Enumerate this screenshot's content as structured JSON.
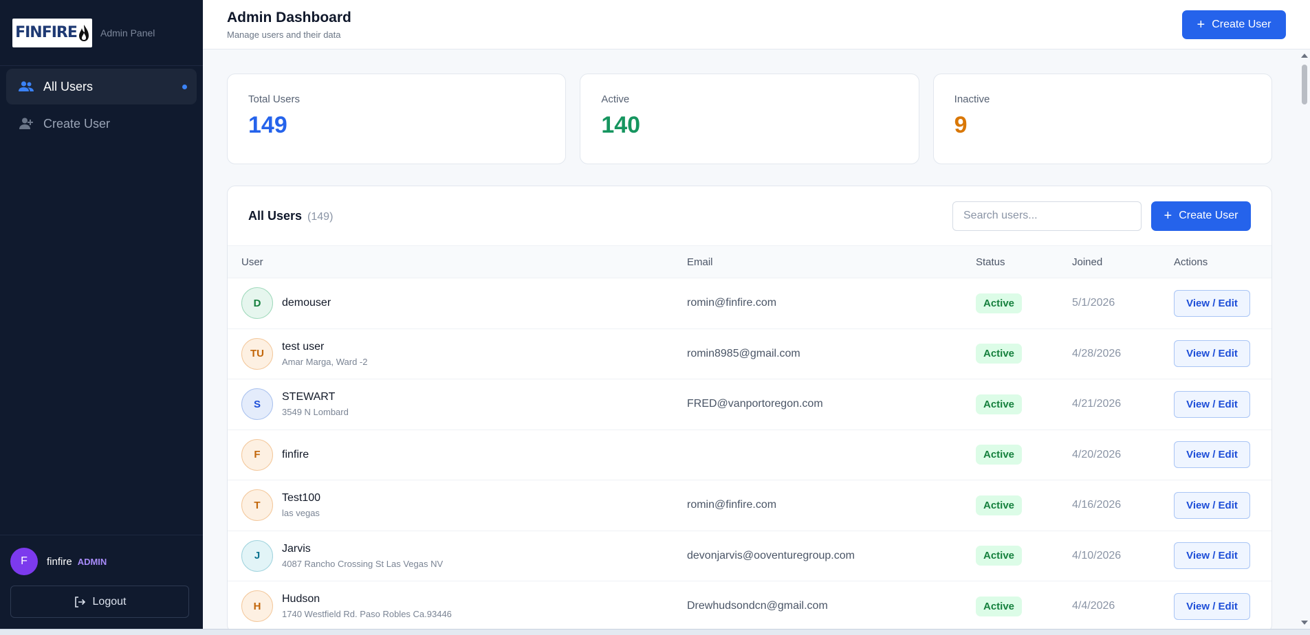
{
  "brand": {
    "logo_text": "FINFIRE",
    "subtitle": "Admin Panel"
  },
  "sidebar": {
    "items": [
      {
        "label": "All Users",
        "icon": "users-icon",
        "active": true
      },
      {
        "label": "Create User",
        "icon": "user-plus-icon",
        "active": false
      }
    ],
    "user": {
      "initial": "F",
      "name": "finfire",
      "role": "ADMIN"
    },
    "logout_label": "Logout"
  },
  "header": {
    "title": "Admin Dashboard",
    "subtitle": "Manage users and their data",
    "create_label": "Create User"
  },
  "stats": [
    {
      "label": "Total Users",
      "value": "149",
      "color": "#2563eb"
    },
    {
      "label": "Active",
      "value": "140",
      "color": "#16955f"
    },
    {
      "label": "Inactive",
      "value": "9",
      "color": "#d97706"
    }
  ],
  "panel": {
    "title": "All Users",
    "count": "(149)",
    "search_placeholder": "Search users...",
    "create_label": "Create User"
  },
  "table": {
    "headers": [
      "User",
      "Email",
      "Status",
      "Joined",
      "Actions"
    ],
    "action_label": "View / Edit",
    "rows": [
      {
        "initials": "D",
        "name": "demouser",
        "address": "",
        "email": "romin@finfire.com",
        "status": "Active",
        "joined": "5/1/2026",
        "avatar_color": "green"
      },
      {
        "initials": "TU",
        "name": "test user",
        "address": "Amar Marga, Ward -2",
        "email": "romin8985@gmail.com",
        "status": "Active",
        "joined": "4/28/2026",
        "avatar_color": "orange"
      },
      {
        "initials": "S",
        "name": "STEWART",
        "address": "3549 N Lombard",
        "email": "FRED@vanportoregon.com",
        "status": "Active",
        "joined": "4/21/2026",
        "avatar_color": "blue"
      },
      {
        "initials": "F",
        "name": "finfire",
        "address": "",
        "email": "",
        "status": "Active",
        "joined": "4/20/2026",
        "avatar_color": "orange"
      },
      {
        "initials": "T",
        "name": "Test100",
        "address": "las vegas",
        "email": "romin@finfire.com",
        "status": "Active",
        "joined": "4/16/2026",
        "avatar_color": "orange"
      },
      {
        "initials": "J",
        "name": "Jarvis",
        "address": "4087 Rancho Crossing St Las Vegas NV",
        "email": "devonjarvis@ooventuregroup.com",
        "status": "Active",
        "joined": "4/10/2026",
        "avatar_color": "teal"
      },
      {
        "initials": "H",
        "name": "Hudson",
        "address": "1740 Westfield Rd. Paso Robles Ca.93446",
        "email": "Drewhudsondcn@gmail.com",
        "status": "Active",
        "joined": "4/4/2026",
        "avatar_color": "orange"
      }
    ]
  }
}
